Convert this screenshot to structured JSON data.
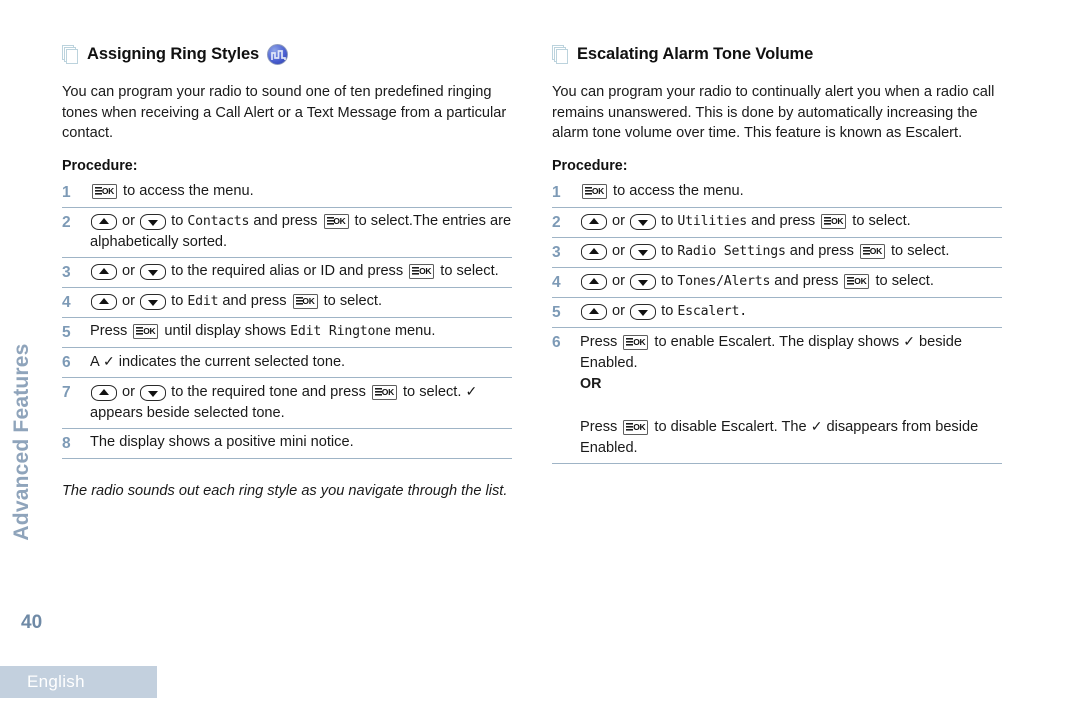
{
  "chapter_tab": "Advanced Features",
  "page_number": "40",
  "footer": {
    "language": "English"
  },
  "icons": {
    "pages": "stacked-pages-icon",
    "ringtone_badge": "ringtone-badge-icon",
    "key_ok": "menu-ok-key-icon",
    "key_up": "up-arrow-key-icon",
    "key_down": "down-arrow-key-icon",
    "check": "check-mark-icon"
  },
  "colors": {
    "accent_blue_grey": "#7d9ab6",
    "rule": "#9fb4c6",
    "footer_bar": "#c3d0de",
    "chapter_tab_text": "#8fa4bb",
    "badge_blue": "#4a5fd0"
  },
  "left_column": {
    "heading": "Assigning Ring Styles",
    "has_ringtone_badge": true,
    "intro": "You can program your radio to sound one of ten predefined ringing tones when receiving a Call Alert or a Text Message from a particular contact.",
    "procedure_label": "Procedure:",
    "steps": [
      {
        "num": "1",
        "parts": [
          {
            "t": "key",
            "key": "ok"
          },
          {
            "t": "text",
            "v": " to access the menu."
          }
        ]
      },
      {
        "num": "2",
        "parts": [
          {
            "t": "key",
            "key": "up"
          },
          {
            "t": "text",
            "v": " or "
          },
          {
            "t": "key",
            "key": "down"
          },
          {
            "t": "text",
            "v": " to "
          },
          {
            "t": "lcd",
            "v": "Contacts"
          },
          {
            "t": "text",
            "v": " and press "
          },
          {
            "t": "key",
            "key": "ok"
          },
          {
            "t": "text",
            "v": " to select.The entries are alphabetically sorted."
          }
        ]
      },
      {
        "num": "3",
        "parts": [
          {
            "t": "key",
            "key": "up"
          },
          {
            "t": "text",
            "v": " or "
          },
          {
            "t": "key",
            "key": "down"
          },
          {
            "t": "text",
            "v": " to the required alias or ID and press "
          },
          {
            "t": "key",
            "key": "ok"
          },
          {
            "t": "text",
            "v": " to select."
          }
        ]
      },
      {
        "num": "4",
        "parts": [
          {
            "t": "key",
            "key": "up"
          },
          {
            "t": "text",
            "v": " or "
          },
          {
            "t": "key",
            "key": "down"
          },
          {
            "t": "text",
            "v": " to "
          },
          {
            "t": "lcd",
            "v": "Edit"
          },
          {
            "t": "text",
            "v": " and press "
          },
          {
            "t": "key",
            "key": "ok"
          },
          {
            "t": "text",
            "v": " to select."
          }
        ]
      },
      {
        "num": "5",
        "parts": [
          {
            "t": "text",
            "v": "Press "
          },
          {
            "t": "key",
            "key": "ok"
          },
          {
            "t": "text",
            "v": " until display shows "
          },
          {
            "t": "lcd",
            "v": "Edit Ringtone"
          },
          {
            "t": "text",
            "v": " menu."
          }
        ]
      },
      {
        "num": "6",
        "parts": [
          {
            "t": "text",
            "v": "A "
          },
          {
            "t": "check"
          },
          {
            "t": "text",
            "v": " indicates the current selected tone."
          }
        ]
      },
      {
        "num": "7",
        "parts": [
          {
            "t": "key",
            "key": "up"
          },
          {
            "t": "text",
            "v": " or "
          },
          {
            "t": "key",
            "key": "down"
          },
          {
            "t": "text",
            "v": " to the required tone and press "
          },
          {
            "t": "key",
            "key": "ok"
          },
          {
            "t": "text",
            "v": " to select. "
          },
          {
            "t": "check"
          },
          {
            "t": "text",
            "v": " appears beside selected tone."
          }
        ]
      },
      {
        "num": "8",
        "parts": [
          {
            "t": "text",
            "v": "The display shows a positive mini notice."
          }
        ]
      }
    ],
    "note": "The radio sounds out each ring style as you navigate through the list."
  },
  "right_column": {
    "heading": "Escalating Alarm Tone Volume",
    "has_ringtone_badge": false,
    "intro": "You can program your radio to continually alert you when a radio call remains unanswered. This is done by automatically increasing the alarm tone volume over time. This feature is known as Escalert.",
    "procedure_label": "Procedure:",
    "steps": [
      {
        "num": "1",
        "parts": [
          {
            "t": "key",
            "key": "ok"
          },
          {
            "t": "text",
            "v": " to access the menu."
          }
        ]
      },
      {
        "num": "2",
        "parts": [
          {
            "t": "key",
            "key": "up"
          },
          {
            "t": "text",
            "v": " or "
          },
          {
            "t": "key",
            "key": "down"
          },
          {
            "t": "text",
            "v": " to "
          },
          {
            "t": "lcd",
            "v": "Utilities"
          },
          {
            "t": "text",
            "v": " and press "
          },
          {
            "t": "key",
            "key": "ok"
          },
          {
            "t": "text",
            "v": " to select."
          }
        ]
      },
      {
        "num": "3",
        "parts": [
          {
            "t": "key",
            "key": "up"
          },
          {
            "t": "text",
            "v": " or "
          },
          {
            "t": "key",
            "key": "down"
          },
          {
            "t": "text",
            "v": " to "
          },
          {
            "t": "lcd",
            "v": "Radio Settings"
          },
          {
            "t": "text",
            "v": " and press "
          },
          {
            "t": "key",
            "key": "ok"
          },
          {
            "t": "text",
            "v": " to select."
          }
        ]
      },
      {
        "num": "4",
        "parts": [
          {
            "t": "key",
            "key": "up"
          },
          {
            "t": "text",
            "v": " or "
          },
          {
            "t": "key",
            "key": "down"
          },
          {
            "t": "text",
            "v": " to "
          },
          {
            "t": "lcd",
            "v": "Tones/Alerts"
          },
          {
            "t": "text",
            "v": " and press "
          },
          {
            "t": "key",
            "key": "ok"
          },
          {
            "t": "text",
            "v": " to select."
          }
        ]
      },
      {
        "num": "5",
        "parts": [
          {
            "t": "key",
            "key": "up"
          },
          {
            "t": "text",
            "v": " or "
          },
          {
            "t": "key",
            "key": "down"
          },
          {
            "t": "text",
            "v": " to "
          },
          {
            "t": "lcd",
            "v": "Escalert."
          }
        ]
      },
      {
        "num": "6",
        "parts": [
          {
            "t": "text",
            "v": "Press "
          },
          {
            "t": "key",
            "key": "ok"
          },
          {
            "t": "text",
            "v": " to enable Escalert. The display shows "
          },
          {
            "t": "check"
          },
          {
            "t": "text",
            "v": " beside Enabled."
          },
          {
            "t": "br"
          },
          {
            "t": "bold",
            "v": "OR"
          },
          {
            "t": "br"
          },
          {
            "t": "text",
            "v": "Press "
          },
          {
            "t": "key",
            "key": "ok"
          },
          {
            "t": "text",
            "v": " to disable Escalert. The "
          },
          {
            "t": "check"
          },
          {
            "t": "text",
            "v": " disappears from beside Enabled."
          }
        ]
      }
    ],
    "note": ""
  }
}
